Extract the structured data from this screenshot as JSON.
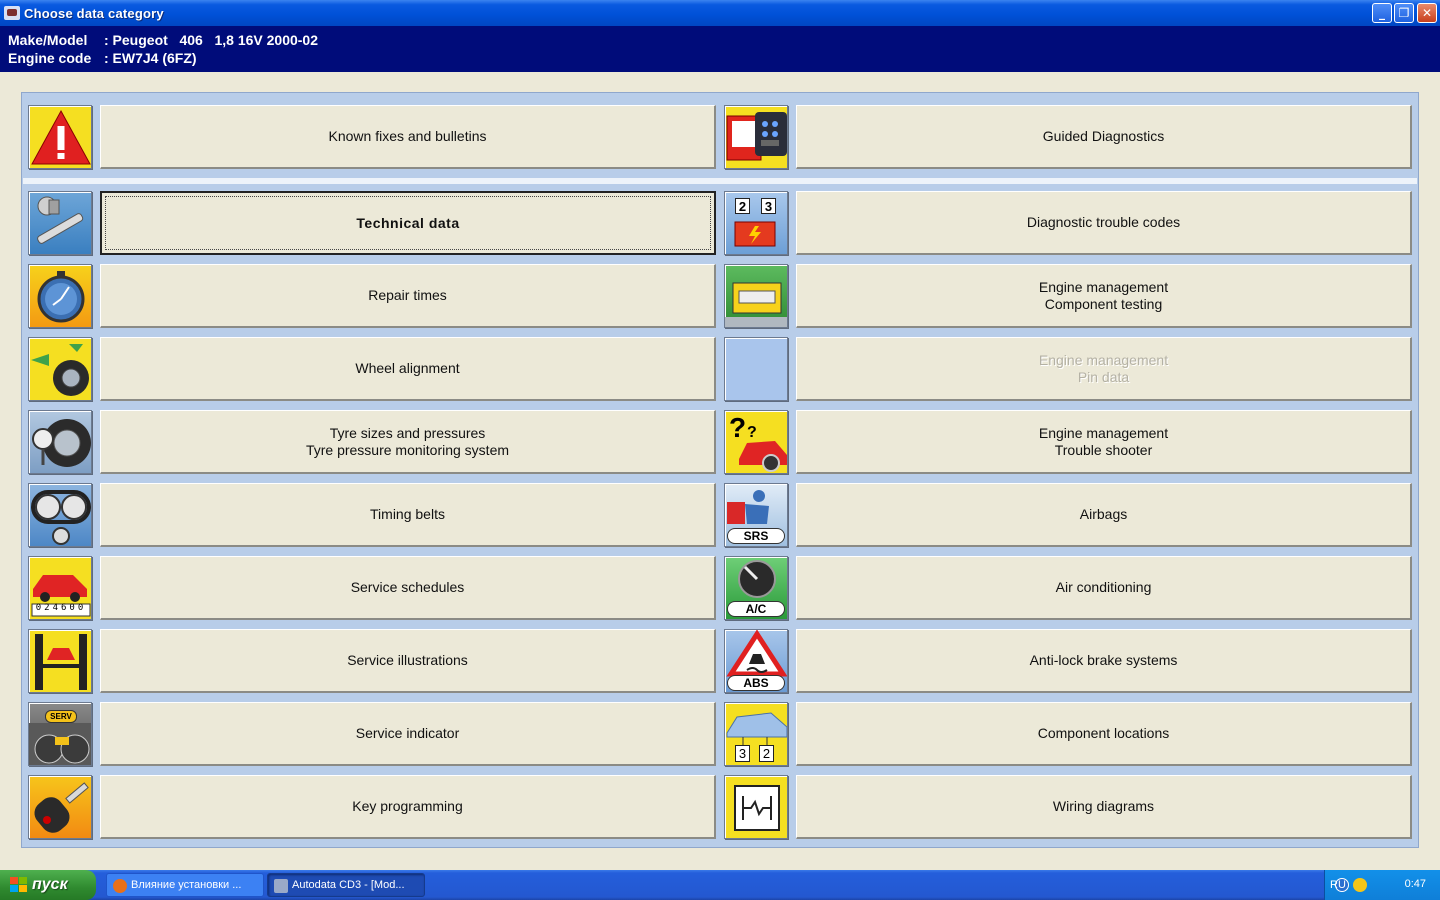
{
  "window": {
    "title": "Choose data category"
  },
  "header": {
    "make_label": "Make/Model",
    "make_value": ": Peugeot   406   1,8 16V 2000-02",
    "engine_label": "Engine code",
    "engine_value": ": EW7J4 (6FZ)"
  },
  "top": {
    "left": {
      "label": "Known fixes and bulletins",
      "icon": "warning-triangle-icon"
    },
    "right": {
      "label": "Guided Diagnostics",
      "icon": "diagnostic-tool-icon"
    }
  },
  "left_items": [
    {
      "label": "Technical data",
      "icon": "wrench-icon",
      "selected": true
    },
    {
      "label": "Repair times",
      "icon": "stopwatch-icon"
    },
    {
      "label": "Wheel alignment",
      "icon": "wheel-alignment-icon"
    },
    {
      "label": "Tyre sizes and pressures",
      "label2": "Tyre pressure monitoring system",
      "icon": "tyre-gauge-icon"
    },
    {
      "label": "Timing belts",
      "icon": "timing-belt-icon"
    },
    {
      "label": "Service schedules",
      "icon": "car-odometer-icon",
      "odometer": "024600"
    },
    {
      "label": "Service illustrations",
      "icon": "car-lift-icon"
    },
    {
      "label": "Service indicator",
      "icon": "serv-dashboard-icon",
      "badge": "SERV"
    },
    {
      "label": "Key programming",
      "icon": "car-key-icon"
    }
  ],
  "right_items": [
    {
      "label": "Diagnostic trouble codes",
      "icon": "trouble-codes-icon",
      "codes": [
        "2",
        "3"
      ]
    },
    {
      "label": "Engine management",
      "label2": "Component testing",
      "icon": "ecu-component-icon"
    },
    {
      "label": "Engine management",
      "label2": "Pin data",
      "icon": "blank-icon",
      "disabled": true
    },
    {
      "label": "Engine management",
      "label2": "Trouble shooter",
      "icon": "question-car-icon"
    },
    {
      "label": "Airbags",
      "icon": "srs-airbag-icon",
      "badge": "SRS"
    },
    {
      "label": "Air conditioning",
      "icon": "ac-dial-icon",
      "badge": "A/C"
    },
    {
      "label": "Anti-lock brake systems",
      "icon": "abs-warning-icon",
      "badge": "ABS"
    },
    {
      "label": "Component locations",
      "icon": "component-location-icon",
      "codes": [
        "3",
        "2"
      ]
    },
    {
      "label": "Wiring diagrams",
      "icon": "wiring-diagram-icon"
    }
  ],
  "taskbar": {
    "start_label": "пуск",
    "tasks": [
      "Влияние установки ...",
      "Autodata CD3 - [Mod..."
    ],
    "lang": "RU",
    "clock": "0:47"
  },
  "colors": {
    "title_bar": "#0051d8",
    "header_bg": "#000c7a",
    "panel_bg": "#b8cde9",
    "button_face": "#ece9d8",
    "disabled_text": "#b4b1a4"
  }
}
